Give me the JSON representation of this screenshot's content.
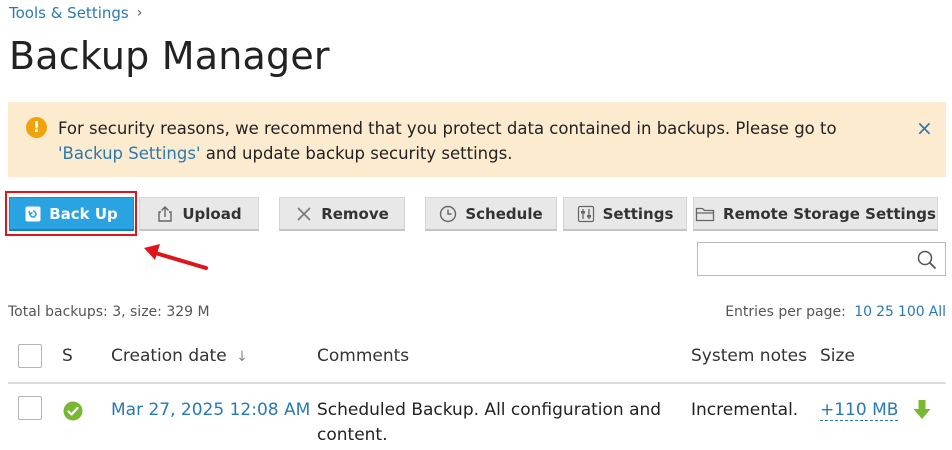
{
  "breadcrumb": {
    "label": "Tools & Settings",
    "separator": "›"
  },
  "page": {
    "title": "Backup Manager"
  },
  "alert": {
    "icon": "warning-icon",
    "text_before": "For security reasons, we recommend that you protect data contained in backups. Please go to ",
    "link": "'Backup Settings'",
    "text_after": " and update backup security settings.",
    "close": "×"
  },
  "toolbar": {
    "backup": "Back Up",
    "upload": "Upload",
    "remove": "Remove",
    "schedule": "Schedule",
    "settings": "Settings",
    "remote_storage": "Remote Storage Settings"
  },
  "search": {
    "placeholder": ""
  },
  "summary": {
    "totals": "Total backups: 3, size: 329 M"
  },
  "pagination": {
    "label": "Entries per page:",
    "options": [
      "10",
      "25",
      "100",
      "All"
    ]
  },
  "table": {
    "headers": {
      "status": "S",
      "creation_date": "Creation date",
      "sort_indicator": "↓",
      "comments": "Comments",
      "system_notes": "System notes",
      "size": "Size"
    },
    "rows": [
      {
        "status": "success",
        "creation_date": "Mar 27, 2025 12:08 AM",
        "comments": "Scheduled Backup. All configuration and content.",
        "system_notes": "Incremental.",
        "size": "+110 MB"
      }
    ]
  },
  "colors": {
    "accent": "#2aa3e2",
    "link": "#2a79b4",
    "alert_bg": "#fdebd0",
    "warning": "#f0a30a",
    "success": "#78b833",
    "highlight": "#e0151b"
  }
}
